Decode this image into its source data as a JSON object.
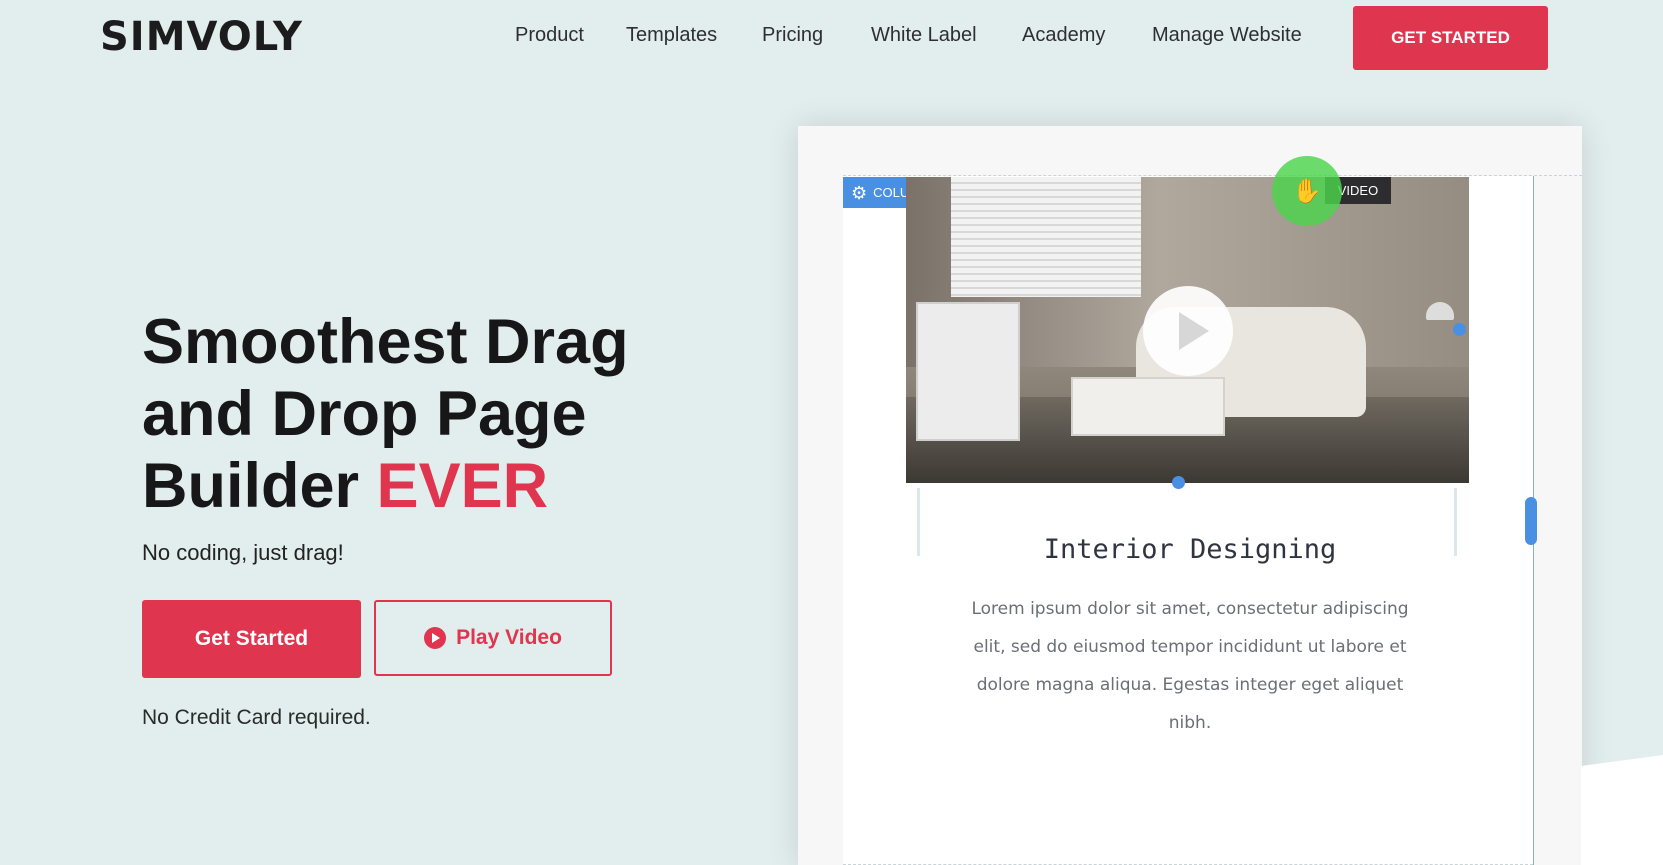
{
  "brand": {
    "logo_text": "SIMVOLY"
  },
  "nav": {
    "items": [
      {
        "label": "Product"
      },
      {
        "label": "Templates"
      },
      {
        "label": "Pricing"
      },
      {
        "label": "White Label"
      },
      {
        "label": "Academy"
      },
      {
        "label": "Manage Website"
      }
    ],
    "cta_label": "GET STARTED"
  },
  "hero": {
    "title_line1": "Smoothest Drag",
    "title_line2": "and Drop Page",
    "title_line3_plain": "Builder",
    "title_line3_accent": "EVER",
    "subtitle": "No coding, just drag!",
    "primary_cta": "Get Started",
    "secondary_cta": "Play Video",
    "note": "No Credit Card required."
  },
  "builder": {
    "column_tag": "COLUMN",
    "video_tag": "VIDEO",
    "card_title": "Interior Designing",
    "card_body": "Lorem ipsum dolor sit amet, consectetur adipiscing elit, sed do eiusmod tempor incididunt ut labore et dolore magna aliqua. Egestas integer eget aliquet nibh."
  },
  "icons": {
    "column_settings": "gear-icon",
    "play_small": "play-icon",
    "play_large": "play-icon",
    "drag_cursor": "hand-cursor-icon"
  },
  "colors": {
    "accent": "#e0354f",
    "page_bg": "#e2eded",
    "selection_blue": "#4a90e2",
    "drag_green": "#4cd44c"
  }
}
